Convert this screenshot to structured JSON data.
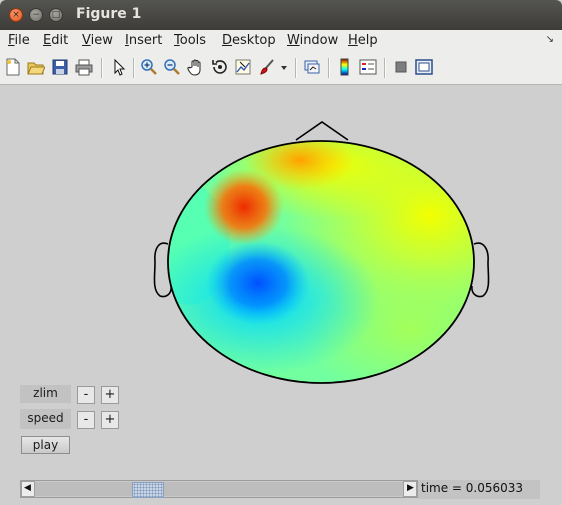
{
  "window": {
    "title": "Figure 1",
    "close_glyph": "×",
    "minimize_glyph": "−",
    "maximize_glyph": "□"
  },
  "menubar": {
    "items": [
      {
        "label": "File",
        "mnemonic": "F",
        "rest": "ile"
      },
      {
        "label": "Edit",
        "mnemonic": "E",
        "rest": "dit"
      },
      {
        "label": "View",
        "mnemonic": "V",
        "rest": "iew"
      },
      {
        "label": "Insert",
        "mnemonic": "I",
        "rest": "nsert"
      },
      {
        "label": "Tools",
        "mnemonic": "T",
        "rest": "ools"
      },
      {
        "label": "Desktop",
        "mnemonic": "D",
        "rest": "esktop"
      },
      {
        "label": "Window",
        "mnemonic": "W",
        "rest": "indow"
      },
      {
        "label": "Help",
        "mnemonic": "H",
        "rest": "elp"
      }
    ],
    "corner_glyph": "↘"
  },
  "toolbar": {
    "icons": [
      "new-figure-icon",
      "open-file-icon",
      "save-icon",
      "print-icon",
      "pointer-icon",
      "zoom-in-icon",
      "zoom-out-icon",
      "pan-hand-icon",
      "rotate-3d-icon",
      "data-cursor-icon",
      "brush-icon",
      "brush-dropdown-icon",
      "link-plot-icon",
      "colorbar-icon",
      "legend-icon",
      "hide-plot-tools-icon",
      "show-plot-tools-icon"
    ]
  },
  "plot": {
    "type": "scalp topography map",
    "colormap": "jet",
    "background": "#cfcfcf"
  },
  "controls": {
    "zlim_label": "zlim",
    "speed_label": "speed",
    "minus": "-",
    "plus": "+",
    "play_label": "play"
  },
  "slider": {
    "left_arrow": "◀",
    "right_arrow": "▶",
    "position_fraction": 0.29
  },
  "status": {
    "time_text": "time = 0.056033"
  }
}
